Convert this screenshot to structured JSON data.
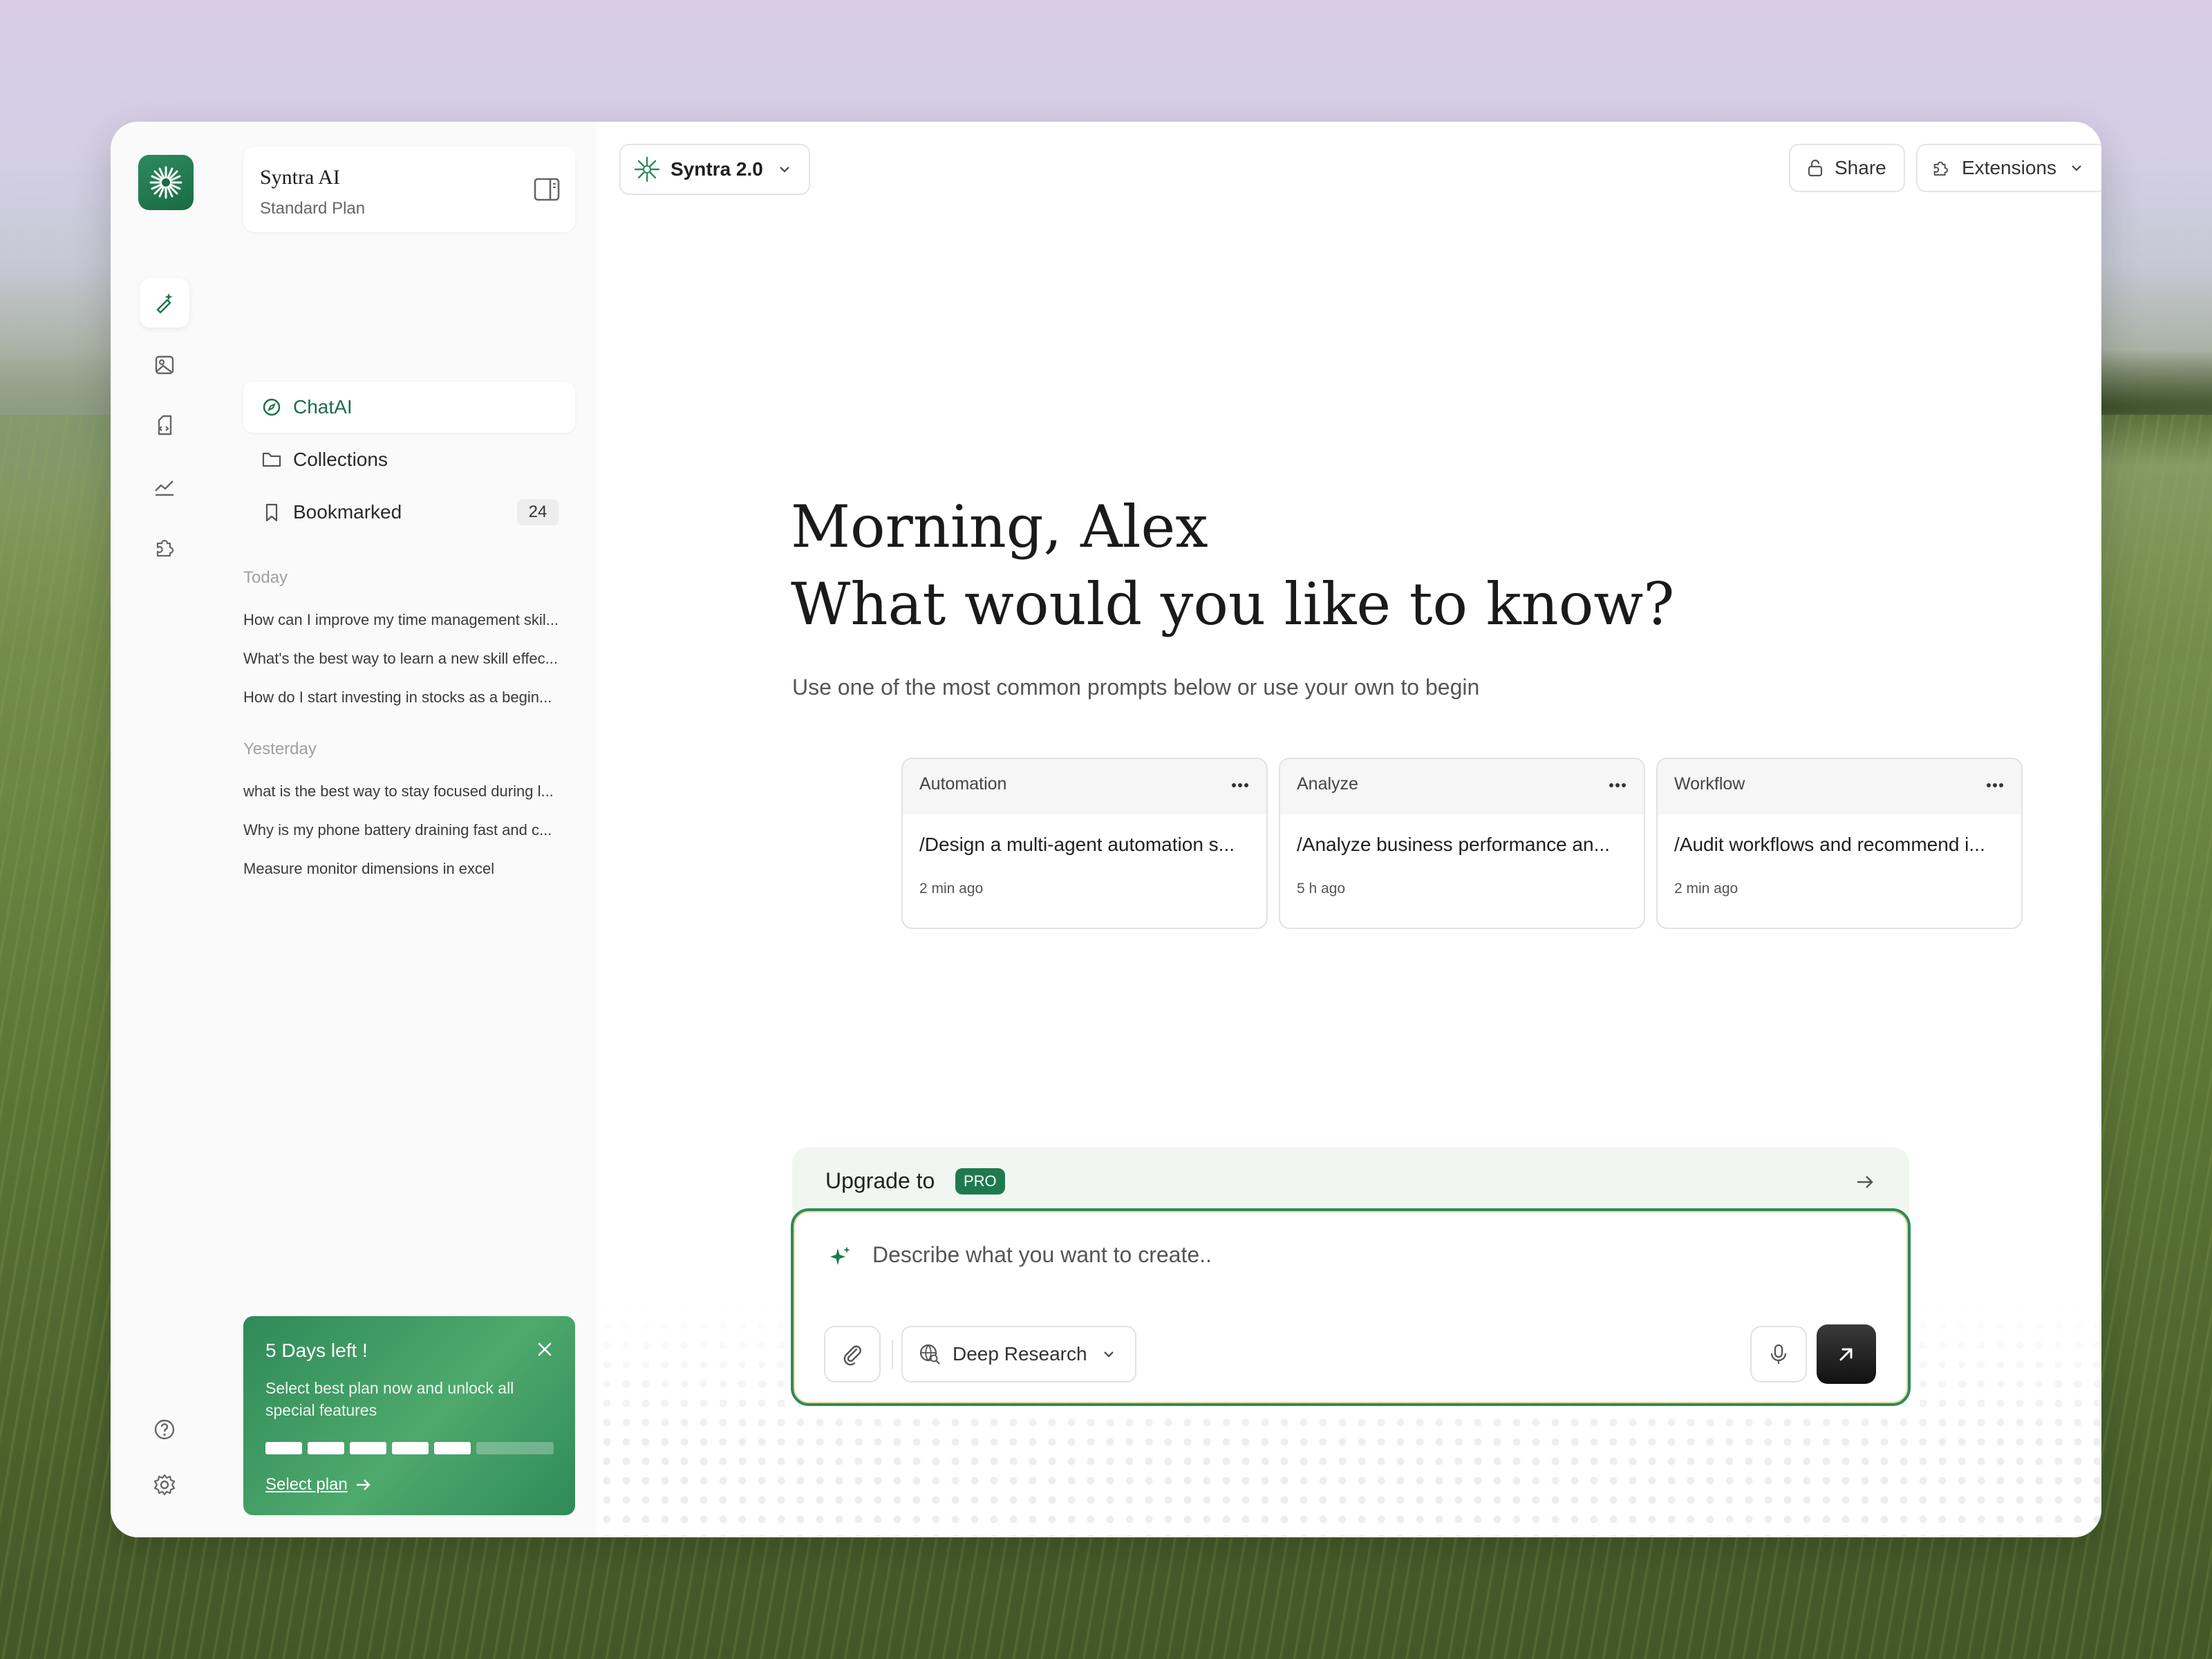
{
  "workspace": {
    "name": "Syntra AI",
    "plan": "Standard Plan"
  },
  "nav": [
    {
      "label": "ChatAI",
      "icon": "compass-icon",
      "active": true
    },
    {
      "label": "Collections",
      "icon": "folder-icon"
    },
    {
      "label": "Bookmarked",
      "icon": "bookmark-icon",
      "count": "24"
    }
  ],
  "history": {
    "today_label": "Today",
    "today": [
      "How can I improve my time management skil...",
      "What's the best way to learn a new skill effec...",
      "How do I start investing in stocks as a begin..."
    ],
    "yesterday_label": "Yesterday",
    "yesterday": [
      "what is the best way to stay focused during l...",
      "Why is my phone battery draining fast and c...",
      "Measure monitor dimensions in excel"
    ]
  },
  "promo": {
    "title": "5 Days left !",
    "text": "Select best plan now and unlock all special features",
    "link": "Select plan",
    "progress_segments_filled": 5,
    "progress_segments_total": 7
  },
  "header": {
    "model": "Syntra 2.0",
    "share": "Share",
    "extensions": "Extensions"
  },
  "hero": {
    "line1": "Morning, Alex",
    "line2": "What would you like to know?",
    "subtitle": "Use one of the most common prompts below or use your own to begin"
  },
  "cards": [
    {
      "category": "Automation",
      "prompt": "/Design a multi-agent automation s...",
      "time": "2 min ago"
    },
    {
      "category": "Analyze",
      "prompt": "/Analyze business performance an...",
      "time": "5 h ago"
    },
    {
      "category": "Workflow",
      "prompt": "/Audit workflows and recommend i...",
      "time": "2 min ago"
    }
  ],
  "upgrade": {
    "label": "Upgrade to",
    "badge": "PRO"
  },
  "composer": {
    "placeholder": "Describe what you want to create..",
    "mode": "Deep Research"
  },
  "colors": {
    "accent": "#1e7a4e",
    "send": "#1a1a1a"
  }
}
